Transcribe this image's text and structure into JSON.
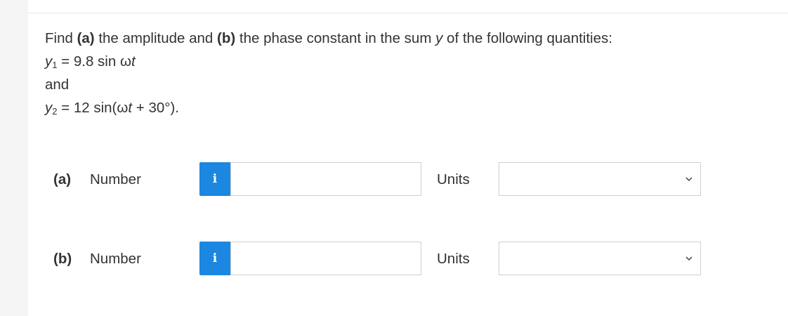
{
  "question": {
    "prefix": "Find ",
    "part_a": "(a)",
    "mid1": " the amplitude and ",
    "part_b": "(b)",
    "mid2": " the phase constant in the sum ",
    "var_y": "y",
    "suffix": " of the following quantities:",
    "eq1_var": "y",
    "eq1_sub": "1",
    "eq1_rhs_a": " = 9.8 sin ω",
    "eq1_rhs_t": "t",
    "and_text": "and",
    "eq2_var": "y",
    "eq2_sub": "2",
    "eq2_rhs_a": " = 12 sin(ω",
    "eq2_rhs_t": "t",
    "eq2_rhs_b": " + 30°)."
  },
  "answers": [
    {
      "part": "(a)",
      "number_label": "Number",
      "info_icon": "i",
      "number_value": "",
      "units_label": "Units",
      "units_value": ""
    },
    {
      "part": "(b)",
      "number_label": "Number",
      "info_icon": "i",
      "number_value": "",
      "units_label": "Units",
      "units_value": ""
    }
  ],
  "colors": {
    "info_button": "#1b87e0",
    "text": "#333333",
    "border": "#cfcfcf"
  },
  "icons": {
    "info": "info-icon",
    "dropdown": "chevron-down-icon"
  }
}
